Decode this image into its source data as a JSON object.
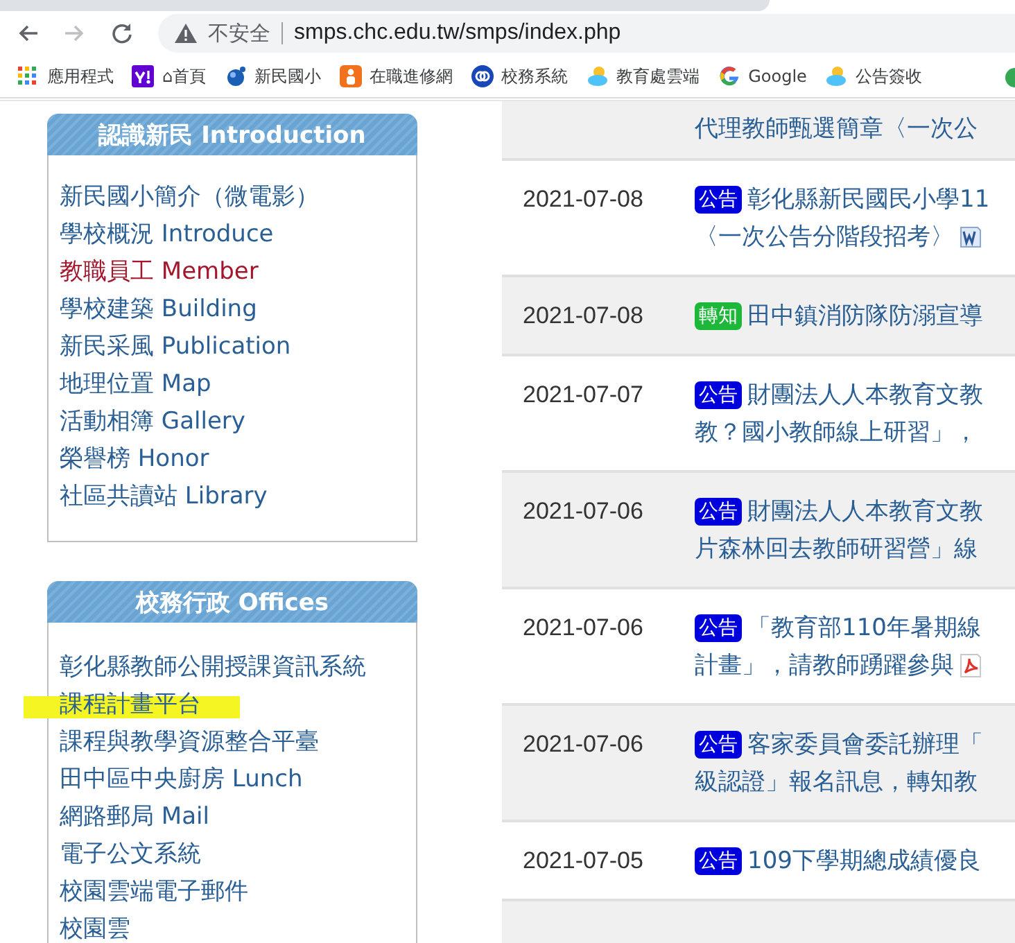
{
  "browser": {
    "nav_buttons": [
      {
        "kind": "back",
        "disabled": false
      },
      {
        "kind": "forward",
        "disabled": true
      },
      {
        "kind": "reload",
        "disabled": false
      }
    ],
    "security": "不安全",
    "url": "smps.chc.edu.tw/smps/index.php",
    "bookmarks": [
      {
        "kind": "apps",
        "label": "應用程式"
      },
      {
        "kind": "yahoo",
        "label": "⌂首頁"
      },
      {
        "kind": "globe",
        "label": "新民國小"
      },
      {
        "kind": "person",
        "label": "在職進修網"
      },
      {
        "kind": "ring",
        "label": "校務系統"
      },
      {
        "kind": "cloud",
        "label": "教育處雲端"
      },
      {
        "kind": "google",
        "label": "Google"
      },
      {
        "kind": "cloud",
        "label": "公告簽收"
      }
    ]
  },
  "sidebar": [
    {
      "title": "認識新民 Introduction",
      "items": [
        {
          "label": "新民國小簡介（微電影）",
          "current": false,
          "highlighted": false
        },
        {
          "label": "學校概況 Introduce",
          "current": false,
          "highlighted": false
        },
        {
          "label": "教職員工 Member",
          "current": true,
          "highlighted": false
        },
        {
          "label": "學校建築 Building",
          "current": false,
          "highlighted": false
        },
        {
          "label": "新民采風 Publication",
          "current": false,
          "highlighted": false
        },
        {
          "label": "地理位置 Map",
          "current": false,
          "highlighted": false
        },
        {
          "label": "活動相簿 Gallery",
          "current": false,
          "highlighted": false
        },
        {
          "label": "榮譽榜 Honor",
          "current": false,
          "highlighted": false
        },
        {
          "label": "社區共讀站 Library",
          "current": false,
          "highlighted": false
        }
      ]
    },
    {
      "title": "校務行政 Offices",
      "items": [
        {
          "label": "彰化縣教師公開授課資訊系統",
          "current": false,
          "highlighted": false
        },
        {
          "label": "課程計畫平台",
          "current": false,
          "highlighted": true
        },
        {
          "label": "課程與教學資源整合平臺",
          "current": false,
          "highlighted": false
        },
        {
          "label": "田中區中央廚房 Lunch",
          "current": false,
          "highlighted": false
        },
        {
          "label": "網路郵局 Mail",
          "current": false,
          "highlighted": false
        },
        {
          "label": "電子公文系統",
          "current": false,
          "highlighted": false
        },
        {
          "label": "校園雲端電子郵件",
          "current": false,
          "highlighted": false
        },
        {
          "label": "校園雲",
          "current": false,
          "highlighted": false
        }
      ]
    }
  ],
  "news": [
    {
      "kind": "partial",
      "lines": [
        "代理教師甄選簡章〈一次公"
      ]
    },
    {
      "kind": "doc",
      "date": "2021-07-08",
      "tag": "公告",
      "color": "#0000dd",
      "lines": [
        "彰化縣新民國民小學11",
        "〈一次公告分階段招考〉"
      ]
    },
    {
      "kind": "plain",
      "date": "2021-07-08",
      "tag": "轉知",
      "color": "#1db83a",
      "lines": [
        "田中鎮消防隊防溺宣導"
      ]
    },
    {
      "kind": "plain",
      "date": "2021-07-07",
      "tag": "公告",
      "color": "#0000dd",
      "lines": [
        "財團法人人本教育文教",
        "教？國小教師線上研習」，"
      ]
    },
    {
      "kind": "plain",
      "date": "2021-07-06",
      "tag": "公告",
      "color": "#0000dd",
      "lines": [
        "財團法人人本教育文教",
        "片森林回去教師研習營」線"
      ]
    },
    {
      "kind": "pdf",
      "date": "2021-07-06",
      "tag": "公告",
      "color": "#0000dd",
      "lines": [
        "「教育部110年暑期線",
        "計畫」，請教師踴躍參與"
      ]
    },
    {
      "kind": "plain",
      "date": "2021-07-06",
      "tag": "公告",
      "color": "#0000dd",
      "lines": [
        "客家委員會委託辦理「",
        "級認證」報名訊息，轉知教"
      ]
    },
    {
      "kind": "plain",
      "date": "2021-07-05",
      "tag": "公告",
      "color": "#0000dd",
      "lines": [
        "109下學期總成績優良"
      ]
    },
    {
      "kind": "blank"
    }
  ]
}
